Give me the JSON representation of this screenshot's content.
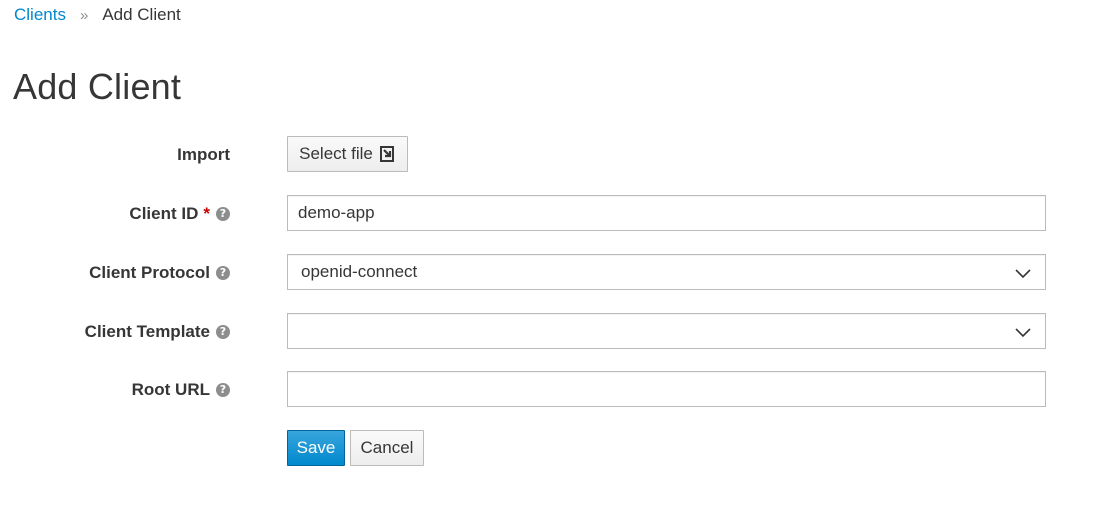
{
  "breadcrumb": {
    "parent": "Clients",
    "separator": "»",
    "current": "Add Client"
  },
  "page": {
    "title": "Add Client"
  },
  "form": {
    "import": {
      "label": "Import",
      "button_label": "Select file"
    },
    "client_id": {
      "label": "Client ID",
      "required_mark": "*",
      "value": "demo-app"
    },
    "client_protocol": {
      "label": "Client Protocol",
      "selected": "openid-connect"
    },
    "client_template": {
      "label": "Client Template",
      "selected": ""
    },
    "root_url": {
      "label": "Root URL",
      "value": ""
    }
  },
  "actions": {
    "save_label": "Save",
    "cancel_label": "Cancel"
  },
  "colors": {
    "link": "#0088ce",
    "primary": "#0088ce",
    "required": "#cc0000"
  }
}
